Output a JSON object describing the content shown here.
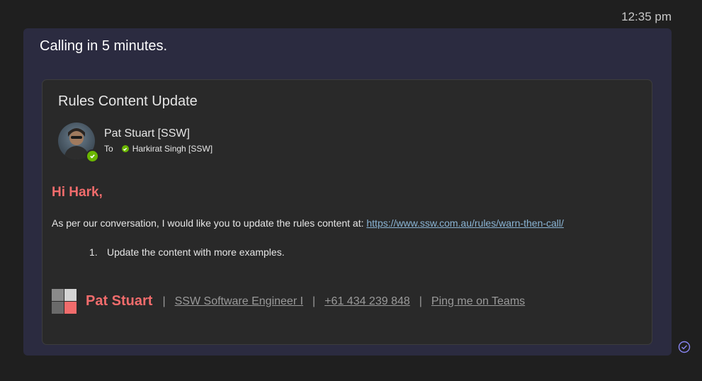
{
  "message": {
    "timestamp": "12:35 pm",
    "text": "Calling in 5 minutes."
  },
  "card": {
    "subject": "Rules Content Update",
    "sender": "Pat Stuart [SSW]",
    "to_label": "To",
    "recipient": "Harkirat Singh [SSW]",
    "presence_status": "available",
    "presence_color": "#6bb700",
    "greeting": "Hi Hark,",
    "body_text": "As per our conversation, I would like you to update the rules content at: ",
    "body_link": "https://www.ssw.com.au/rules/warn-then-call/",
    "list": [
      {
        "number": "1.",
        "text": "Update the content with more examples."
      }
    ],
    "signature": {
      "name": "Pat Stuart",
      "separator": "|",
      "links": [
        "SSW Software Engineer I",
        "+61 434 239 848",
        "Ping me on Teams"
      ]
    }
  },
  "colors": {
    "accent": "#f16c6c",
    "link": "#8ab4d4",
    "bubble": "#2b2b40",
    "seen_icon": "#8a86f4"
  },
  "icons": {
    "avatar": "avatar-photo",
    "presence": "check-icon",
    "logo": "ssw-logo-icon",
    "seen": "seen-check-icon"
  }
}
